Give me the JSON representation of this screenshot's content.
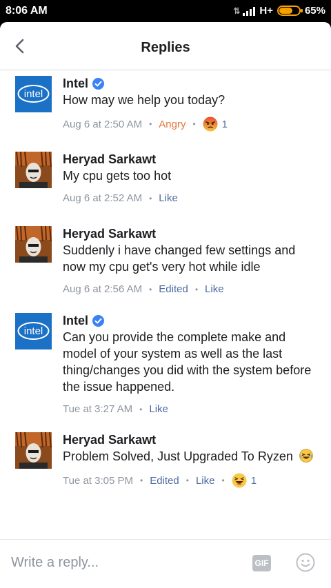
{
  "status_bar": {
    "time": "8:06 AM",
    "network": "H+",
    "battery_percent": "65%",
    "battery_level": 0.65
  },
  "header": {
    "title": "Replies"
  },
  "comments": [
    {
      "author": "Intel",
      "verified": true,
      "avatar": "intel-logo",
      "text": "How may we help you today?",
      "time": "Aug 6 at 2:50 AM",
      "reaction_label": "Angry",
      "reaction_icon": "angry-emoji-icon",
      "reaction_count": "1"
    },
    {
      "author": "Heryad Sarkawt",
      "verified": false,
      "avatar": "user-photo",
      "text": "My cpu gets too hot",
      "time": "Aug 6 at 2:52 AM",
      "like_label": "Like"
    },
    {
      "author": "Heryad Sarkawt",
      "verified": false,
      "avatar": "user-photo",
      "text": "Suddenly i have changed few settings and now my cpu get's very hot while idle",
      "time": "Aug 6 at 2:56 AM",
      "edited_label": "Edited",
      "like_label": "Like"
    },
    {
      "author": "Intel",
      "verified": true,
      "avatar": "intel-logo",
      "text": "Can you provide the complete make and model of your system as well as the last thing/changes you did with the system before the issue happened.",
      "time": "Tue at 3:27 AM",
      "like_label": "Like"
    },
    {
      "author": "Heryad Sarkawt",
      "verified": false,
      "avatar": "user-photo",
      "text": "Problem Solved, Just Upgraded To Ryzen",
      "text_emoji": "laughing-emoji-icon",
      "time": "Tue at 3:05 PM",
      "edited_label": "Edited",
      "like_label": "Like",
      "reaction_icon": "haha-emoji-icon",
      "reaction_count": "1"
    }
  ],
  "composer": {
    "placeholder": "Write a reply...",
    "gif_label": "GIF",
    "emoji_icon": "smiley-face-icon"
  },
  "colors": {
    "link": "#4b6aa0",
    "angry": "#e8743b",
    "meta": "#8d949e",
    "intel_blue": "#1a71c6",
    "verified": "#3b82f6"
  }
}
